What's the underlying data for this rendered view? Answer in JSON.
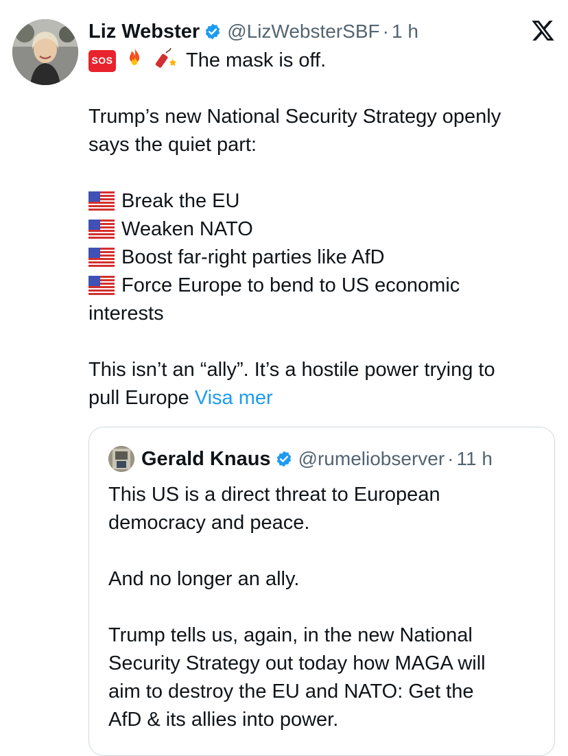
{
  "tweet": {
    "author_name": "Liz Webster",
    "handle": "@LizWebsterSBF",
    "separator": "·",
    "time": "1 h",
    "emoji_badge": "SOS",
    "first_line": "The mask is off.",
    "paragraph1": [
      "Trump’s new National Security Strategy openly",
      "says the quiet part:"
    ],
    "bullets": [
      "Break the EU",
      "Weaken NATO",
      "Boost far-right parties like AfD",
      "Force Europe to bend to US economic"
    ],
    "bullet_continuation": "interests",
    "paragraph3_line1": "This isn’t an “ally”. It’s a hostile power trying to",
    "paragraph3_line2": "pull Europe",
    "show_more": "Visa mer",
    "icons": {
      "verified": "verified-badge-icon",
      "platform": "x-logo-icon",
      "flag": "us-flag-icon",
      "fire": "fire-icon",
      "firecracker": "firecracker-icon"
    },
    "colors": {
      "link": "#1d9bf0",
      "secondary": "#536471",
      "badge": "#1d9bf0"
    }
  },
  "quote": {
    "author_name": "Gerald Knaus",
    "handle": "@rumeliobserver",
    "separator": "·",
    "time": "11 h",
    "lines": [
      "This US is a direct threat to European",
      "democracy and peace.",
      "",
      "And no longer an ally.",
      "",
      "Trump tells us, again, in the new National",
      "Security Strategy out today how MAGA will",
      "aim to destroy the EU and NATO: Get the",
      "AfD & its allies into power."
    ]
  }
}
